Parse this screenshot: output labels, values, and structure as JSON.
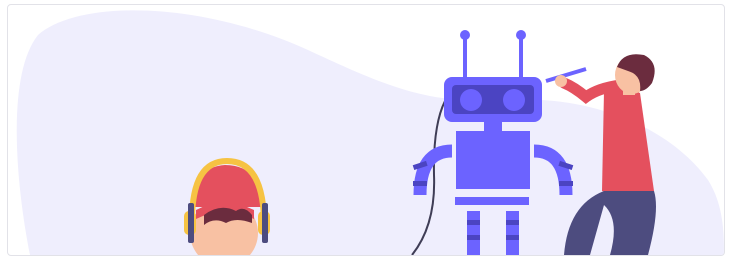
{
  "card": {
    "illustration_name": "robot-building-illustration"
  },
  "colors": {
    "blob": "#efeefd",
    "robot_primary": "#6c63ff",
    "robot_dark": "#4b44c2",
    "shirt": "#e4505e",
    "skin": "#f8c1a3",
    "hair": "#6b2c3e",
    "pants": "#4d4c7f",
    "headphones": "#f6c343",
    "cable": "#3f3d56"
  }
}
